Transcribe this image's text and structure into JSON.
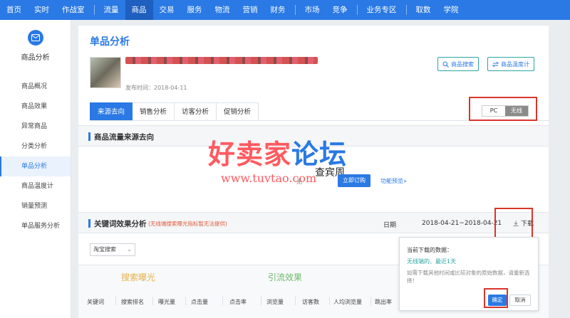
{
  "topnav": {
    "items": [
      "首页",
      "实时",
      "作战室",
      "流量",
      "商品",
      "交易",
      "服务",
      "物流",
      "营销",
      "财务",
      "市场",
      "竞争",
      "业务专区",
      "取数",
      "学院"
    ],
    "active_index": 4
  },
  "sidebar": {
    "title": "商品分析",
    "items": [
      "商品概况",
      "商品效果",
      "异常商品",
      "分类分析",
      "单品分析",
      "商品温度计",
      "销量预测",
      "单品服务分析"
    ],
    "active_index": 4
  },
  "page": {
    "title": "单品分析",
    "publish_time": "发布时间：2018-04-11",
    "search_button": "商品搜索",
    "thermo_button": "商品温度计"
  },
  "tabs": [
    "来源去向",
    "销售分析",
    "访客分析",
    "促销分析"
  ],
  "device_toggle": {
    "options": [
      "PC",
      "无线"
    ],
    "selected": "无线"
  },
  "flow_section": {
    "title": "商品流量来源去向",
    "no_data_text": "无",
    "buy_button": "立即订购",
    "preview_link": "功能预览»"
  },
  "watermark": {
    "brand_a": "好卖家",
    "brand_b": "论坛",
    "url": "www.tuvtao.com",
    "name": "查宾周"
  },
  "keyword_section": {
    "title": "关键词效果分析",
    "note": "(无线端搜索曝光指标暂无法提供)",
    "date_label": "日期",
    "date_range": "2018-04-21~2018-04-21",
    "download_label": "下载",
    "source_select": "淘宝搜索"
  },
  "table": {
    "group_exposure": "搜索曝光",
    "group_traffic": "引流效果",
    "columns": [
      "关键词",
      "搜索排名",
      "曝光量",
      "点击量",
      "点击率",
      "浏览量",
      "访客数",
      "人均浏览量",
      "跳出率"
    ]
  },
  "download_popup": {
    "line1": "当前下载的数据：",
    "line2": "无线端的、最近1天",
    "line3": "如需下载其他时间或比较对象的原始数据，请重新选择！",
    "ok": "确定",
    "cancel": "取消"
  }
}
